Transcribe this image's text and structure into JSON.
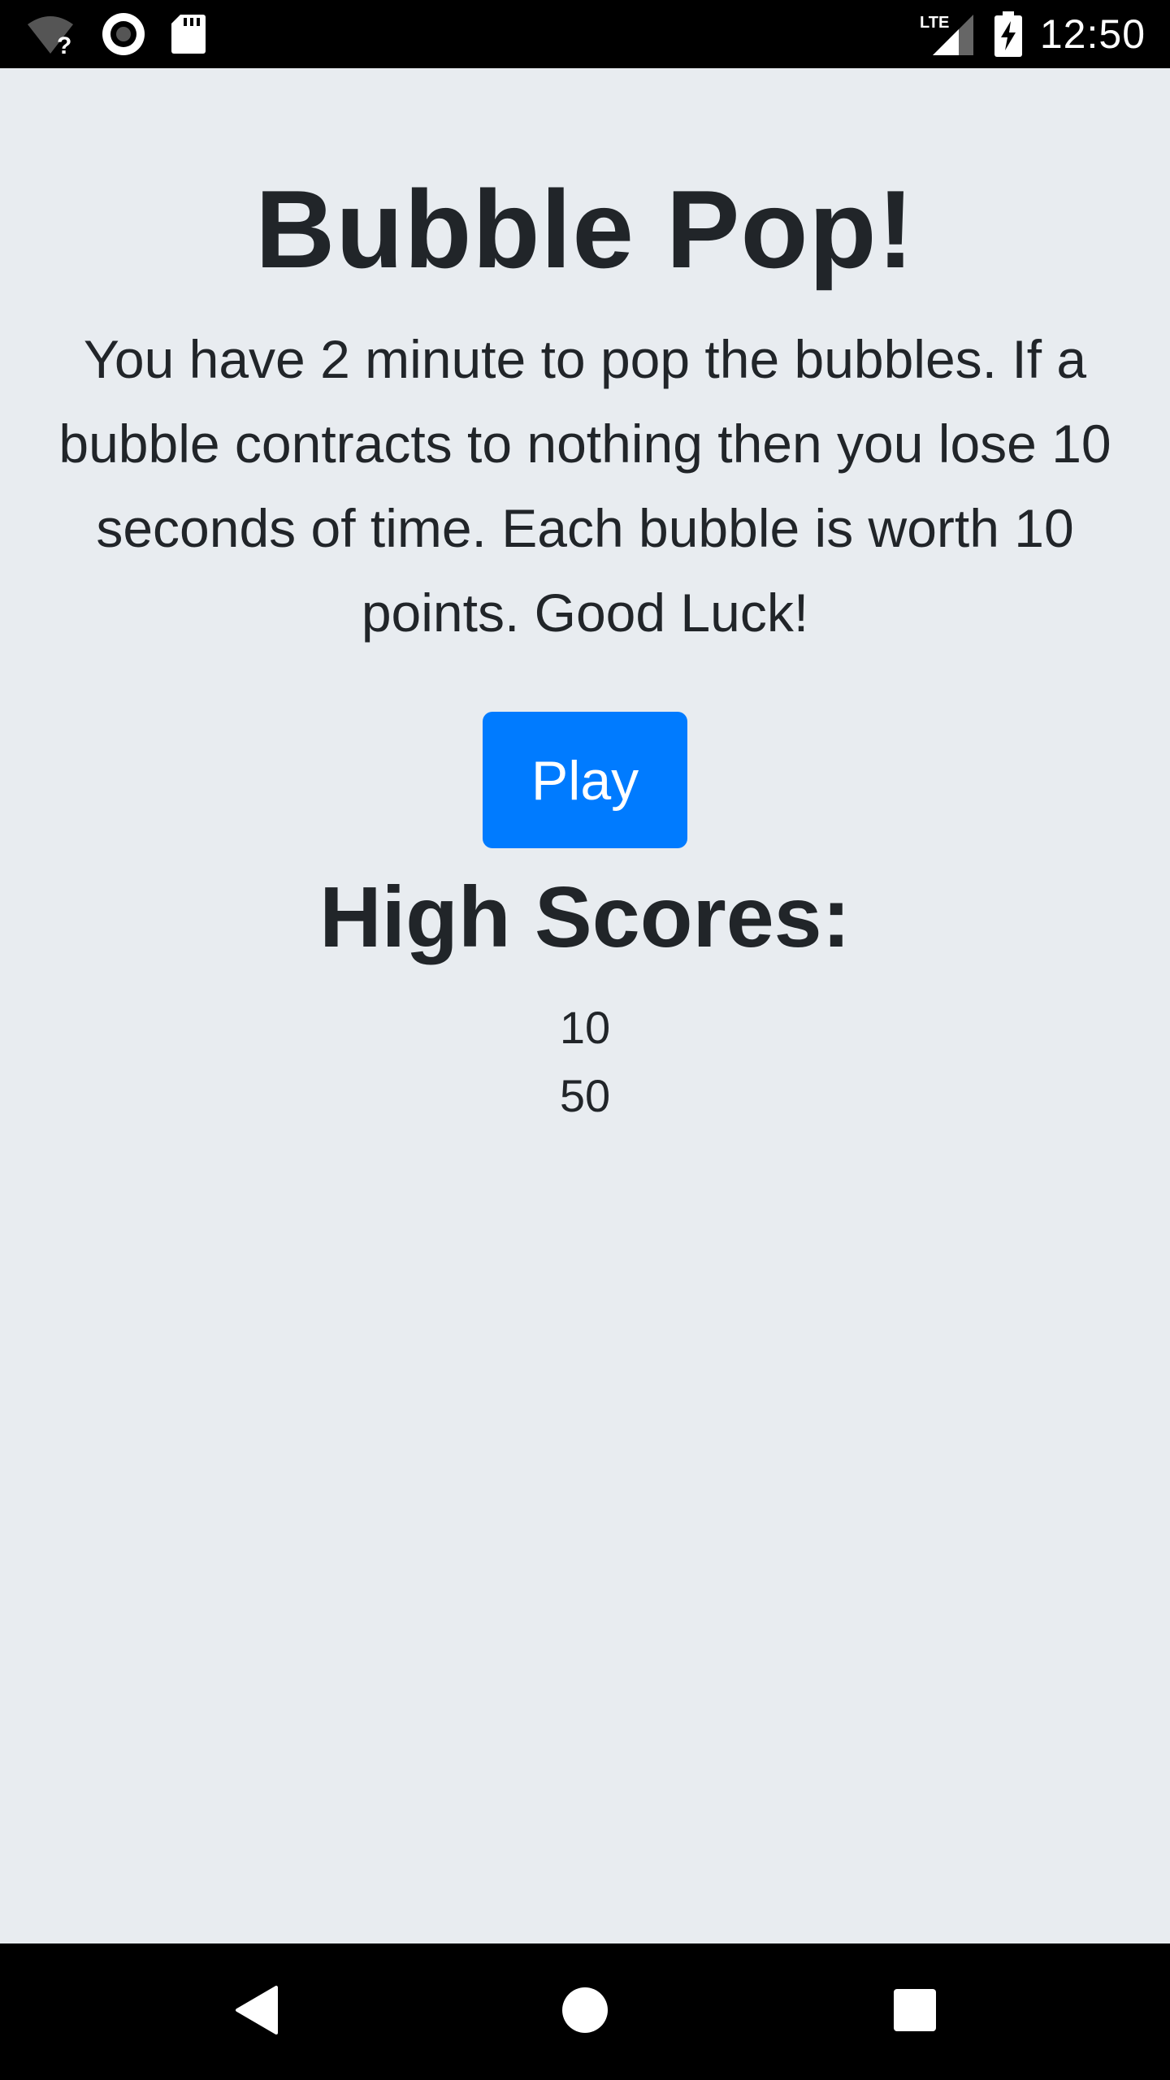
{
  "status_bar": {
    "time": "12:50",
    "network_label": "LTE",
    "icons": [
      "wifi-unknown-icon",
      "circle-indicator-icon",
      "sd-card-icon",
      "lte-signal-icon",
      "battery-charging-icon"
    ]
  },
  "main": {
    "title": "Bubble Pop!",
    "description": "You have 2 minute to pop the bubbles. If a bubble contracts to nothing then you lose 10 seconds of time. Each bubble is worth 10 points. Good Luck!",
    "play_label": "Play",
    "high_scores_title": "High Scores:",
    "scores": [
      "10",
      "50"
    ]
  },
  "nav_bar": {
    "icons": [
      "back-icon",
      "home-icon",
      "recents-icon"
    ]
  },
  "colors": {
    "background": "#e8ecf0",
    "text": "#212529",
    "accent": "#007bff"
  }
}
